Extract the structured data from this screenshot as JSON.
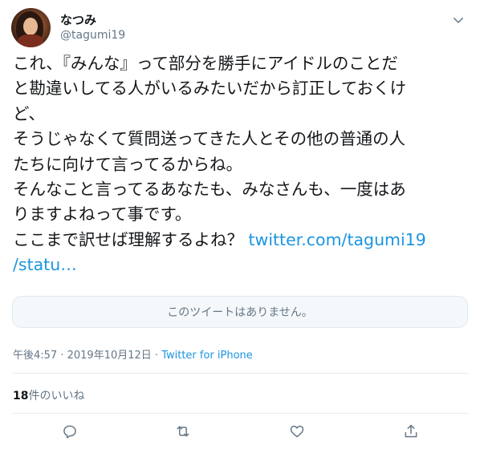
{
  "user": {
    "display_name": "なつみ",
    "handle": "@tagumi19"
  },
  "tweet": {
    "line1": "これ、『みんな』って部分を勝手にアイドルのことだ",
    "line2": "と勘違いしてる人がいるみたいだから訂正しておくけ",
    "line3": "ど、",
    "line4": "そうじゃなくて質問送ってきた人とその他の普通の人",
    "line5": "たちに向けて言ってるからね。",
    "line6": "そんなこと言ってるあなたも、みなさんも、一度はあ",
    "line7": "りますよねって事です。",
    "line8": "ここまで訳せば理解するよね？ ",
    "link_part1": "twitter.com/tagumi19",
    "link_part2": "/statu…"
  },
  "quote": {
    "unavailable_text": "このツイートはありません。"
  },
  "meta": {
    "time": "午後4:57",
    "separator": " · ",
    "date": "2019年10月12日",
    "source": "Twitter for iPhone"
  },
  "likes": {
    "count": "18",
    "label": "件のいいね"
  },
  "icons": {
    "menu": "chevron-down-icon",
    "reply": "reply-icon",
    "retweet": "retweet-icon",
    "like": "heart-icon",
    "share": "share-icon"
  },
  "colors": {
    "link": "#1b95e0",
    "secondary_text": "#657786",
    "primary_text": "#14171a",
    "border": "#e1e8ed"
  }
}
